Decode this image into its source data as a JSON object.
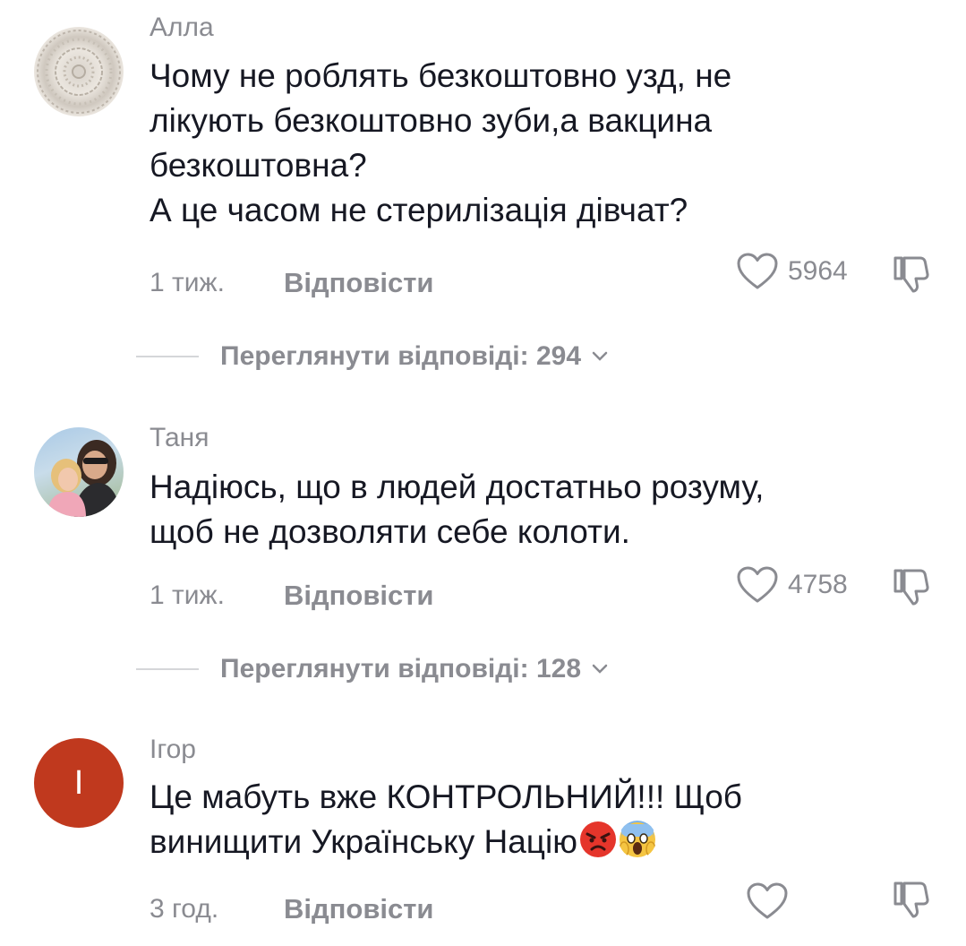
{
  "comments": [
    {
      "username": "Алла",
      "text_lines": [
        "Чому не роблять безкоштовно узд, не",
        "лікують безкоштовно зуби,а вакцина",
        "безкоштовна?",
        "А це часом не стерилізація дівчат?"
      ],
      "time": "1 тиж.",
      "reply_label": "Відповісти",
      "likes": "5964",
      "view_replies": "Переглянути відповіді: 294"
    },
    {
      "username": "Таня",
      "text_lines": [
        "Надіюсь, що в людей достатньо розуму,",
        "щоб не дозволяти себе колоти."
      ],
      "time": "1 тиж.",
      "reply_label": "Відповісти",
      "likes": "4758",
      "view_replies": "Переглянути відповіді: 128"
    },
    {
      "username": "Ігор",
      "avatar_letter": "I",
      "avatar_color": "#c0391e",
      "text_lines": [
        "Це мабуть вже КОНТРОЛЬНИЙ!!! Щоб",
        "винищити Українську Націю"
      ],
      "time": "3 год.",
      "reply_label": "Відповісти",
      "likes": ""
    }
  ],
  "icons": {
    "like": "heart-outline-icon",
    "dislike": "thumbs-down-outline-icon",
    "chevron": "chevron-down-icon",
    "emoji_1": "angry-face-emoji",
    "emoji_2": "screaming-face-emoji"
  },
  "colors": {
    "text": "#161823",
    "secondary": "#8a8b91"
  }
}
